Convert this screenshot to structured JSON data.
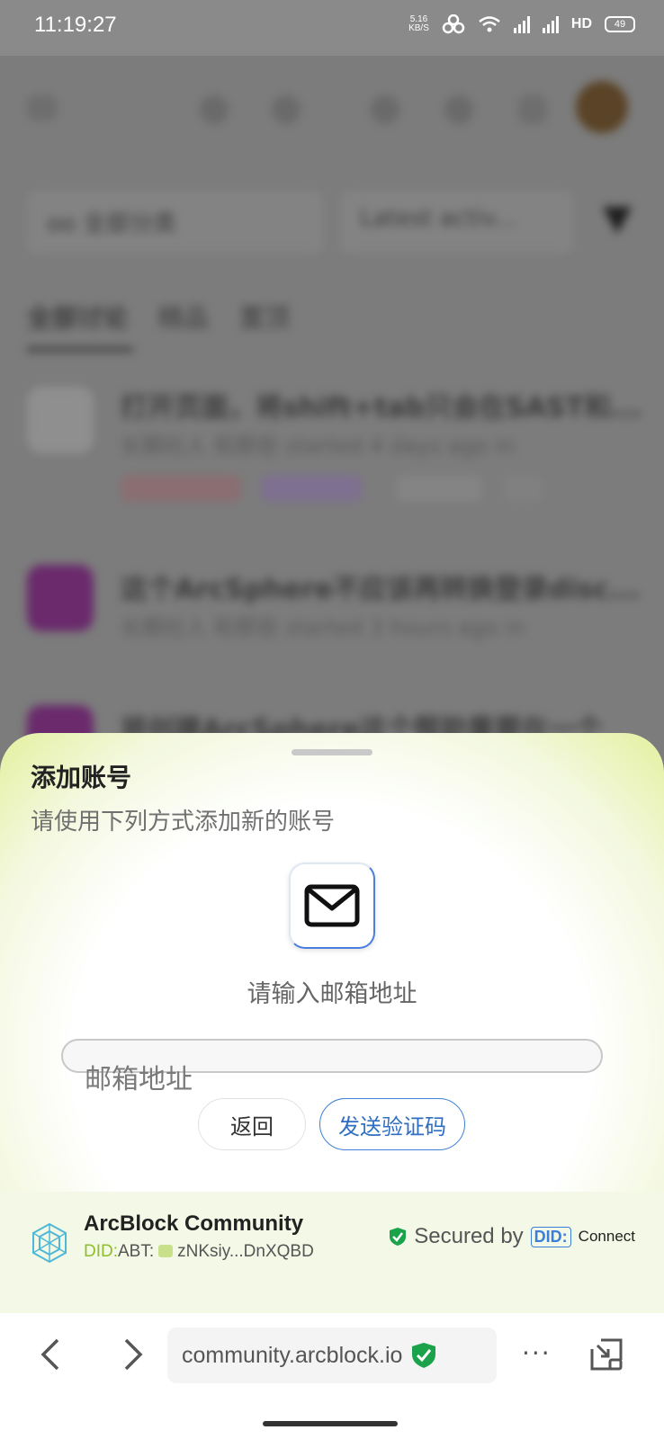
{
  "status_bar": {
    "time": "11:19:27",
    "net_speed_value": "5.16",
    "net_speed_unit": "KB/S",
    "hd_label": "HD",
    "battery": "49"
  },
  "background": {
    "filter_label": "oo 全部分类",
    "sort_label": "Latest activ...",
    "tabs": [
      "全部讨论",
      "精品",
      "置顶"
    ],
    "posts": [
      {
        "title": "打开页面，将shift+tab只会在SAST和...",
        "meta": "长期社人  和那些 started 4 days ago in",
        "tags": [
          "分类已解答",
          "需要升级",
          "我回到"
        ]
      },
      {
        "title": "这个ArcSphere不应该再转换登录disc...",
        "meta": "长期社人  和那些 started 3 hours ago in"
      },
      {
        "title": "将创建ArcSphere这个帮助重要在一个"
      }
    ]
  },
  "sheet": {
    "title": "添加账号",
    "subtitle": "请使用下列方式添加新的账号",
    "email_icon": "mail-icon",
    "prompt": "请输入邮箱地址",
    "email_placeholder": "邮箱地址",
    "back_button": "返回",
    "send_code_button": "发送验证码"
  },
  "app_info": {
    "name": "ArcBlock Community",
    "did_prefix": "DID:",
    "did_chain": "ABT:",
    "did_value": "zNKsiy...DnXQBD",
    "secured_by": "Secured by",
    "did_badge": "DID:",
    "connect": "Connect"
  },
  "browser": {
    "url": "community.arcblock.io",
    "more": "···"
  },
  "colors": {
    "accent_blue": "#3d82d6",
    "shield_green": "#1aa34a",
    "sheet_glow": "#e3f09e"
  }
}
